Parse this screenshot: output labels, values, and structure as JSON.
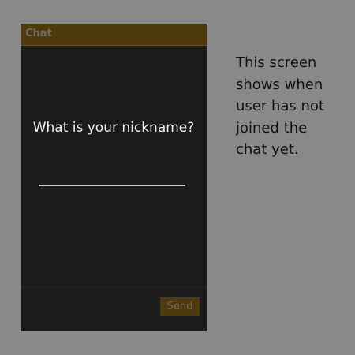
{
  "app": {
    "title": "Chat"
  },
  "login": {
    "prompt": "What is your nickname?",
    "nickname_value": "",
    "nickname_placeholder": ""
  },
  "footer": {
    "send_label": "Send"
  },
  "annotation": {
    "text": "This screen shows when user has not joined the chat yet."
  },
  "colors": {
    "background": "#898989",
    "screen": "#1b1b1b",
    "accent": "#4f3a0c",
    "accent_text": "#6e6a63",
    "text": "#f0f0f0"
  }
}
